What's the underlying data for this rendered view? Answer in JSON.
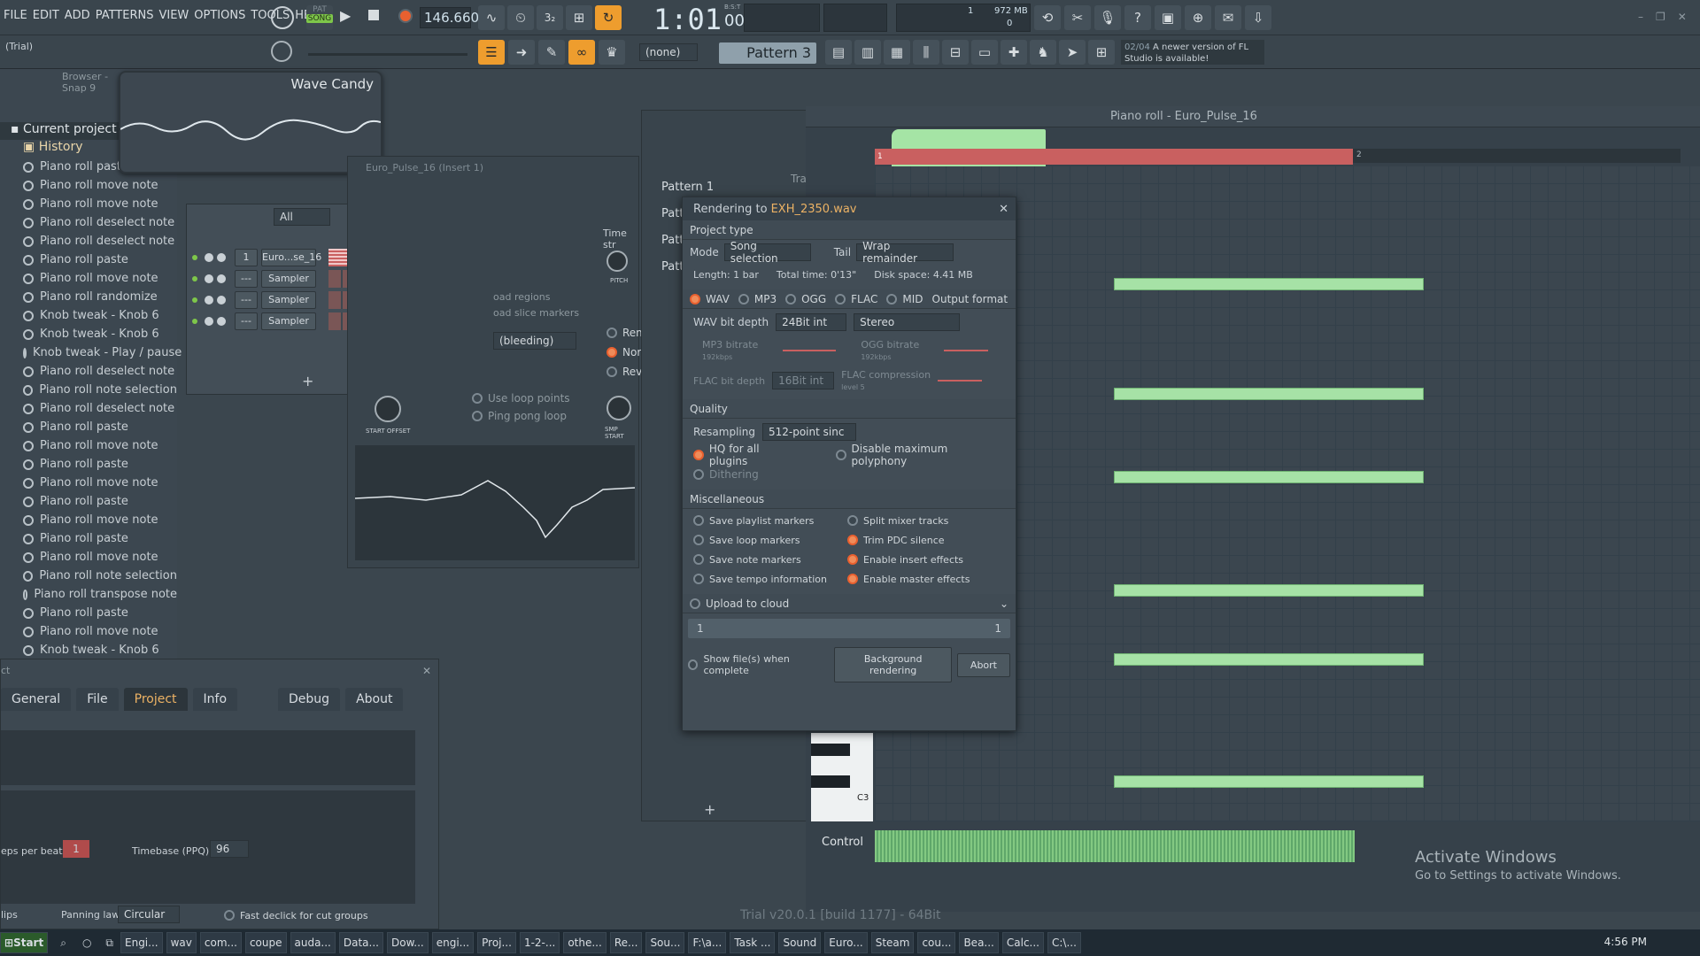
{
  "menu": [
    "FILE",
    "EDIT",
    "ADD",
    "PATTERNS",
    "VIEW",
    "OPTIONS",
    "TOOLS",
    "HELP"
  ],
  "transport": {
    "song_label": "SONG",
    "pat_label": "PAT",
    "bpm": "146.660",
    "time": "1:01",
    "time_sub": "00",
    "time_label": "B:S:T",
    "cpu_num": "1",
    "mem": "972 MB",
    "mem_val": "0"
  },
  "trial": "(Trial)",
  "pattern": {
    "none_label": "(none)",
    "pattern_label": "Pattern 3"
  },
  "hint": {
    "page": "02/04",
    "text": "A newer version of FL Studio is available!"
  },
  "browser": {
    "title": "Browser - Snap 9",
    "current_project": "Current project",
    "history": "History",
    "items": [
      "Piano roll paste",
      "Piano roll move note",
      "Piano roll move note",
      "Piano roll deselect note",
      "Piano roll deselect note",
      "Piano roll paste",
      "Piano roll move note",
      "Piano roll randomize",
      "Knob tweak - Knob 6",
      "Knob tweak - Knob 6",
      "Knob tweak - Play / pause",
      "Piano roll deselect note",
      "Piano roll note selection",
      "Piano roll deselect note",
      "Piano roll paste",
      "Piano roll move note",
      "Piano roll paste",
      "Piano roll move note",
      "Piano roll paste",
      "Piano roll move note",
      "Piano roll paste",
      "Piano roll move note",
      "Piano roll note selection",
      "Piano roll transpose note",
      "Piano roll paste",
      "Piano roll move note",
      "Knob tweak - Knob 6"
    ]
  },
  "wave_candy": "Wave Candy",
  "channel_rack": {
    "filter": "All",
    "channels": [
      {
        "num": "1",
        "name": "Euro...se_16"
      },
      {
        "num": "---",
        "name": "Sampler"
      },
      {
        "num": "---",
        "name": "Sampler"
      },
      {
        "num": "---",
        "name": "Sampler"
      }
    ]
  },
  "sampler": {
    "title": "Euro_Pulse_16 (Insert 1)",
    "time_str": "Time str",
    "pitch": "PITCH",
    "load_regions": "oad regions",
    "load_slice": "oad slice markers",
    "bleeding": "(bleeding)",
    "rem": "Rem",
    "nor": "Nor",
    "rev": "Reve",
    "use_loop": "Use loop points",
    "ping_pong": "Ping pong loop",
    "start_offset": "START OFFSET",
    "smp_start": "SMP START"
  },
  "picker": {
    "patterns": [
      "Pattern 1",
      "Patt",
      "Patt",
      "Patt"
    ],
    "tra": "Tra"
  },
  "render": {
    "title_prefix": "Rendering to ",
    "filename": "EXH_2350.wav",
    "project_type": "Project type",
    "mode_label": "Mode",
    "mode": "Song selection",
    "tail_label": "Tail",
    "tail": "Wrap remainder",
    "length": "Length: 1 bar",
    "total_time": "Total time: 0'13\"",
    "disk": "Disk space: 4.41 MB",
    "formats": [
      "WAV",
      "MP3",
      "OGG",
      "FLAC",
      "MID"
    ],
    "output_format": "Output format",
    "wav_depth_label": "WAV bit depth",
    "wav_depth": "24Bit int",
    "channels": "Stereo",
    "mp3_bitrate": "MP3 bitrate",
    "mp3_val": "192kbps",
    "ogg_bitrate": "OGG bitrate",
    "ogg_val": "192kbps",
    "flac_depth_label": "FLAC bit depth",
    "flac_depth": "16Bit int",
    "flac_comp": "FLAC compression",
    "flac_level": "level 5",
    "quality": "Quality",
    "resampling_label": "Resampling",
    "resampling": "512-point sinc",
    "hq": "HQ for all plugins",
    "disable_poly": "Disable maximum polyphony",
    "dithering": "Dithering",
    "misc": "Miscellaneous",
    "misc_left": [
      "Save playlist markers",
      "Save loop markers",
      "Save note markers",
      "Save tempo information"
    ],
    "misc_right": [
      "Split mixer tracks",
      "Trim PDC silence",
      "Enable insert effects",
      "Enable master effects"
    ],
    "upload": "Upload to cloud",
    "progress_left": "1",
    "progress_right": "1",
    "show_files": "Show file(s) when complete",
    "background": "Background rendering",
    "abort": "Abort"
  },
  "piano_roll": {
    "title": "Piano roll - Euro_Pulse_16",
    "bar1": "1",
    "bar2": "2",
    "c3": "C3",
    "control": "Control",
    "tra": "Tra"
  },
  "settings": {
    "tabs": [
      "General",
      "File",
      "Project",
      "Info",
      "Debug",
      "About"
    ],
    "steps_label": "eps per beat",
    "steps": "1",
    "timebase_label": "Timebase (PPQ)",
    "timebase": "96",
    "clips": "lips",
    "panning_label": "Panning law",
    "panning": "Circular",
    "fast_declick": "Fast declick for cut groups",
    "title_frag": "ct"
  },
  "watermark": {
    "line1": "Activate Windows",
    "line2": "Go to Settings to activate Windows."
  },
  "trial_footer": "Trial v20.0.1 [build 1177] - 64Bit",
  "taskbar": {
    "start": "Start",
    "items": [
      "Engi...",
      "wav",
      "com...",
      "coupe",
      "auda...",
      "Data...",
      "Dow...",
      "engi...",
      "Proj...",
      "1-2-...",
      "othe...",
      "Re...",
      "Sou...",
      "F:\\a...",
      "Task ...",
      "Sound",
      "Euro...",
      "Steam",
      "cou...",
      "Bea...",
      "Calc...",
      "C:\\..."
    ],
    "clock": "4:56 PM"
  },
  "colors": {
    "accent": "#ee9d2e",
    "note": "#a6e2a6",
    "record": "#e9602f",
    "bar_marker": "#c96060"
  }
}
